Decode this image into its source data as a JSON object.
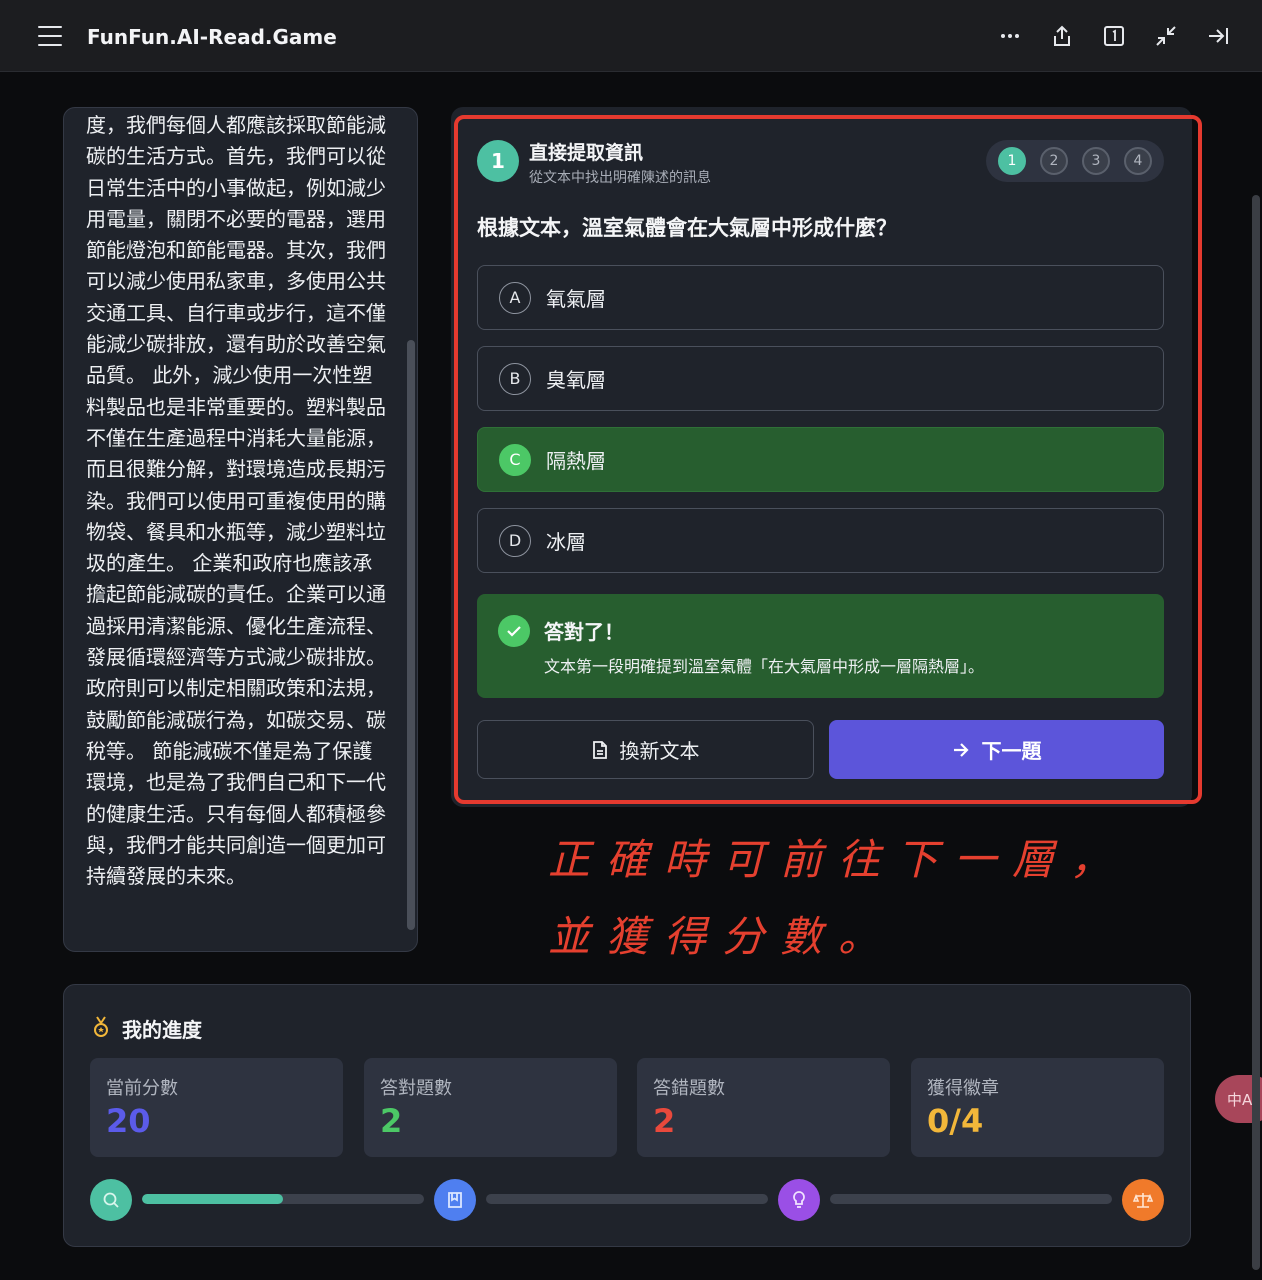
{
  "app": {
    "title": "FunFun.AI-Read.Game"
  },
  "passage": {
    "text": "度，我們每個人都應該採取節能減碳的生活方式。首先，我們可以從日常生活中的小事做起，例如減少用電量，關閉不必要的電器，選用節能燈泡和節能電器。其次，我們可以減少使用私家車，多使用公共交通工具、自行車或步行，這不僅能減少碳排放，還有助於改善空氣品質。 此外，減少使用一次性塑料製品也是非常重要的。塑料製品不僅在生產過程中消耗大量能源，而且很難分解，對環境造成長期污染。我們可以使用可重複使用的購物袋、餐具和水瓶等，減少塑料垃圾的產生。 企業和政府也應該承擔起節能減碳的責任。企業可以通過採用清潔能源、優化生產流程、發展循環經濟等方式減少碳排放。政府則可以制定相關政策和法規，鼓勵節能減碳行為，如碳交易、碳稅等。 節能減碳不僅是為了保護環境，也是為了我們自己和下一代的健康生活。只有每個人都積極參與，我們才能共同創造一個更加可持續發展的未來。"
  },
  "quiz": {
    "step_number": "1",
    "level_title": "直接提取資訊",
    "level_subtitle": "從文本中找出明確陳述的訊息",
    "levels": [
      "1",
      "2",
      "3",
      "4"
    ],
    "current_level": 1,
    "question": "根據文本，溫室氣體會在大氣層中形成什麼？",
    "options": [
      {
        "letter": "A",
        "text": "氧氣層"
      },
      {
        "letter": "B",
        "text": "臭氧層"
      },
      {
        "letter": "C",
        "text": "隔熱層"
      },
      {
        "letter": "D",
        "text": "冰層"
      }
    ],
    "selected_option": "C",
    "feedback": {
      "title": "答對了！",
      "text": "文本第一段明確提到溫室氣體「在大氣層中形成一層隔熱層」。"
    },
    "new_text_label": "換新文本",
    "next_label": "下一題"
  },
  "annotation": {
    "line1": "正確時可前往下一層，",
    "line2": "並獲得分數。"
  },
  "progress": {
    "title": "我的進度",
    "stats": [
      {
        "label": "當前分數",
        "value": "20",
        "color": "#5b5bea"
      },
      {
        "label": "答對題數",
        "value": "2",
        "color": "#4cc866"
      },
      {
        "label": "答錯題數",
        "value": "2",
        "color": "#e9493c"
      },
      {
        "label": "獲得徽章",
        "value": "0/4",
        "color": "#f2b73a"
      }
    ],
    "track_fill": [
      0.5,
      0,
      0
    ],
    "milestone_colors": [
      "#4dc0a2",
      "#4f7ff0",
      "#9a4fe6",
      "#f07a2a"
    ],
    "milestone_icons": [
      "search-icon",
      "book-icon",
      "lightbulb-icon",
      "scale-icon"
    ]
  },
  "translate_button": {
    "label": "中A"
  }
}
